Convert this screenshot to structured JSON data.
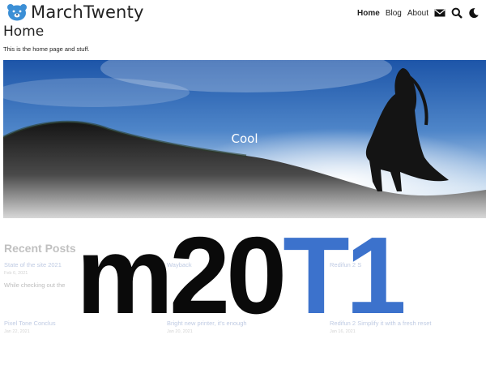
{
  "site": {
    "title": "MarchTwenty",
    "logo": "bear-icon"
  },
  "nav": {
    "items": [
      {
        "label": "Home",
        "active": true
      },
      {
        "label": "Blog",
        "active": false
      },
      {
        "label": "About",
        "active": false
      }
    ],
    "icons": [
      "mail-icon",
      "search-icon",
      "moon-icon"
    ]
  },
  "page": {
    "title": "Home",
    "intro": "This is the home page and stuff.",
    "hero_caption": "Cool"
  },
  "recent": {
    "heading": "Recent Posts",
    "posts": [
      {
        "title": "State of the site 2021",
        "date": "Feb 6, 2021",
        "excerpt": "While checking out the"
      },
      {
        "title": "Wayback",
        "date": "",
        "excerpt": ""
      },
      {
        "title": "Redifun 2 S",
        "date": "",
        "excerpt": ""
      }
    ],
    "more": [
      {
        "title": "Pixel Tone Conclus",
        "date": "Jan 22, 2021"
      },
      {
        "title": "Bright new printer, it's enough",
        "date": "Jan 20, 2021"
      },
      {
        "title": "Redifun 2 Simplify it with a fresh reset",
        "date": "Jan 16, 2021"
      }
    ]
  },
  "overlay": {
    "part1": "m20",
    "part2": "T1"
  },
  "colors": {
    "accent": "#3c72cc",
    "logo": "#3b8fd6"
  }
}
